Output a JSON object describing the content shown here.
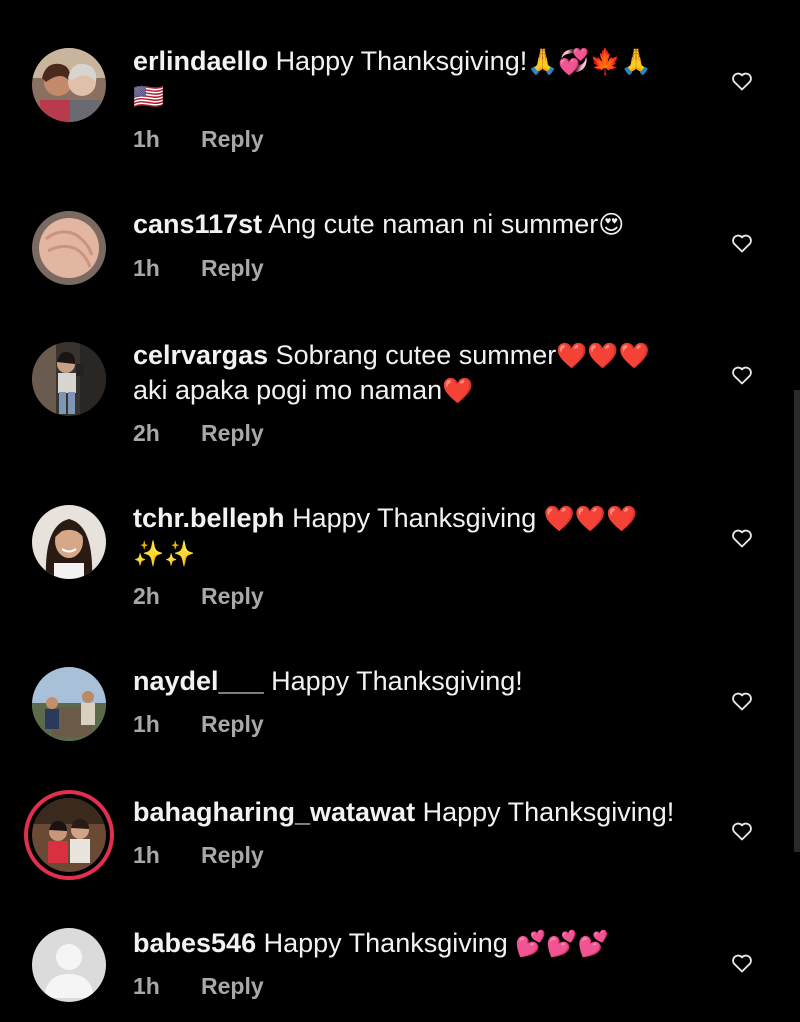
{
  "comments": [
    {
      "username": "erlindaello",
      "text": "Happy Thanksgiving!",
      "emoji": "🙏💞🍁🙏",
      "emoji_line2": "🇺🇸",
      "time": "1h",
      "reply_label": "Reply",
      "avatar_icon": "avatar-photo-two-women"
    },
    {
      "username": "cans117st",
      "text": "Ang cute naman ni summer",
      "emoji": "😍",
      "time": "1h",
      "reply_label": "Reply",
      "avatar_icon": "avatar-photo-skin"
    },
    {
      "username": "celrvargas",
      "text": "Sobrang cutee summer",
      "emoji": "❤️❤️❤️",
      "line2_text": "aki apaka pogi mo naman",
      "line2_emoji": "❤️",
      "time": "2h",
      "reply_label": "Reply",
      "avatar_icon": "avatar-photo-mirror-selfie"
    },
    {
      "username": "tchr.belleph",
      "text": "Happy Thanksgiving",
      "emoji": "❤️❤️❤️",
      "emoji_line2": "✨✨",
      "time": "2h",
      "reply_label": "Reply",
      "avatar_icon": "avatar-photo-woman"
    },
    {
      "username": "naydel___",
      "text": "Happy Thanksgiving!",
      "time": "1h",
      "reply_label": "Reply",
      "avatar_icon": "avatar-photo-two-people-outdoors"
    },
    {
      "username": "bahagharing_watawat",
      "text": "Happy Thanksgiving!",
      "time": "1h",
      "reply_label": "Reply",
      "avatar_icon": "avatar-photo-couple-story-ring"
    },
    {
      "username": "babes546",
      "text": "Happy Thanksgiving",
      "emoji": "💕💕💕",
      "time": "1h",
      "reply_label": "Reply",
      "avatar_icon": "default-avatar-icon"
    }
  ],
  "icons": {
    "like": "heart-outline-icon"
  },
  "colors": {
    "background": "#000000",
    "text": "#f2f2f2",
    "meta": "#a8a8a8",
    "story_ring": "#e0304e"
  }
}
